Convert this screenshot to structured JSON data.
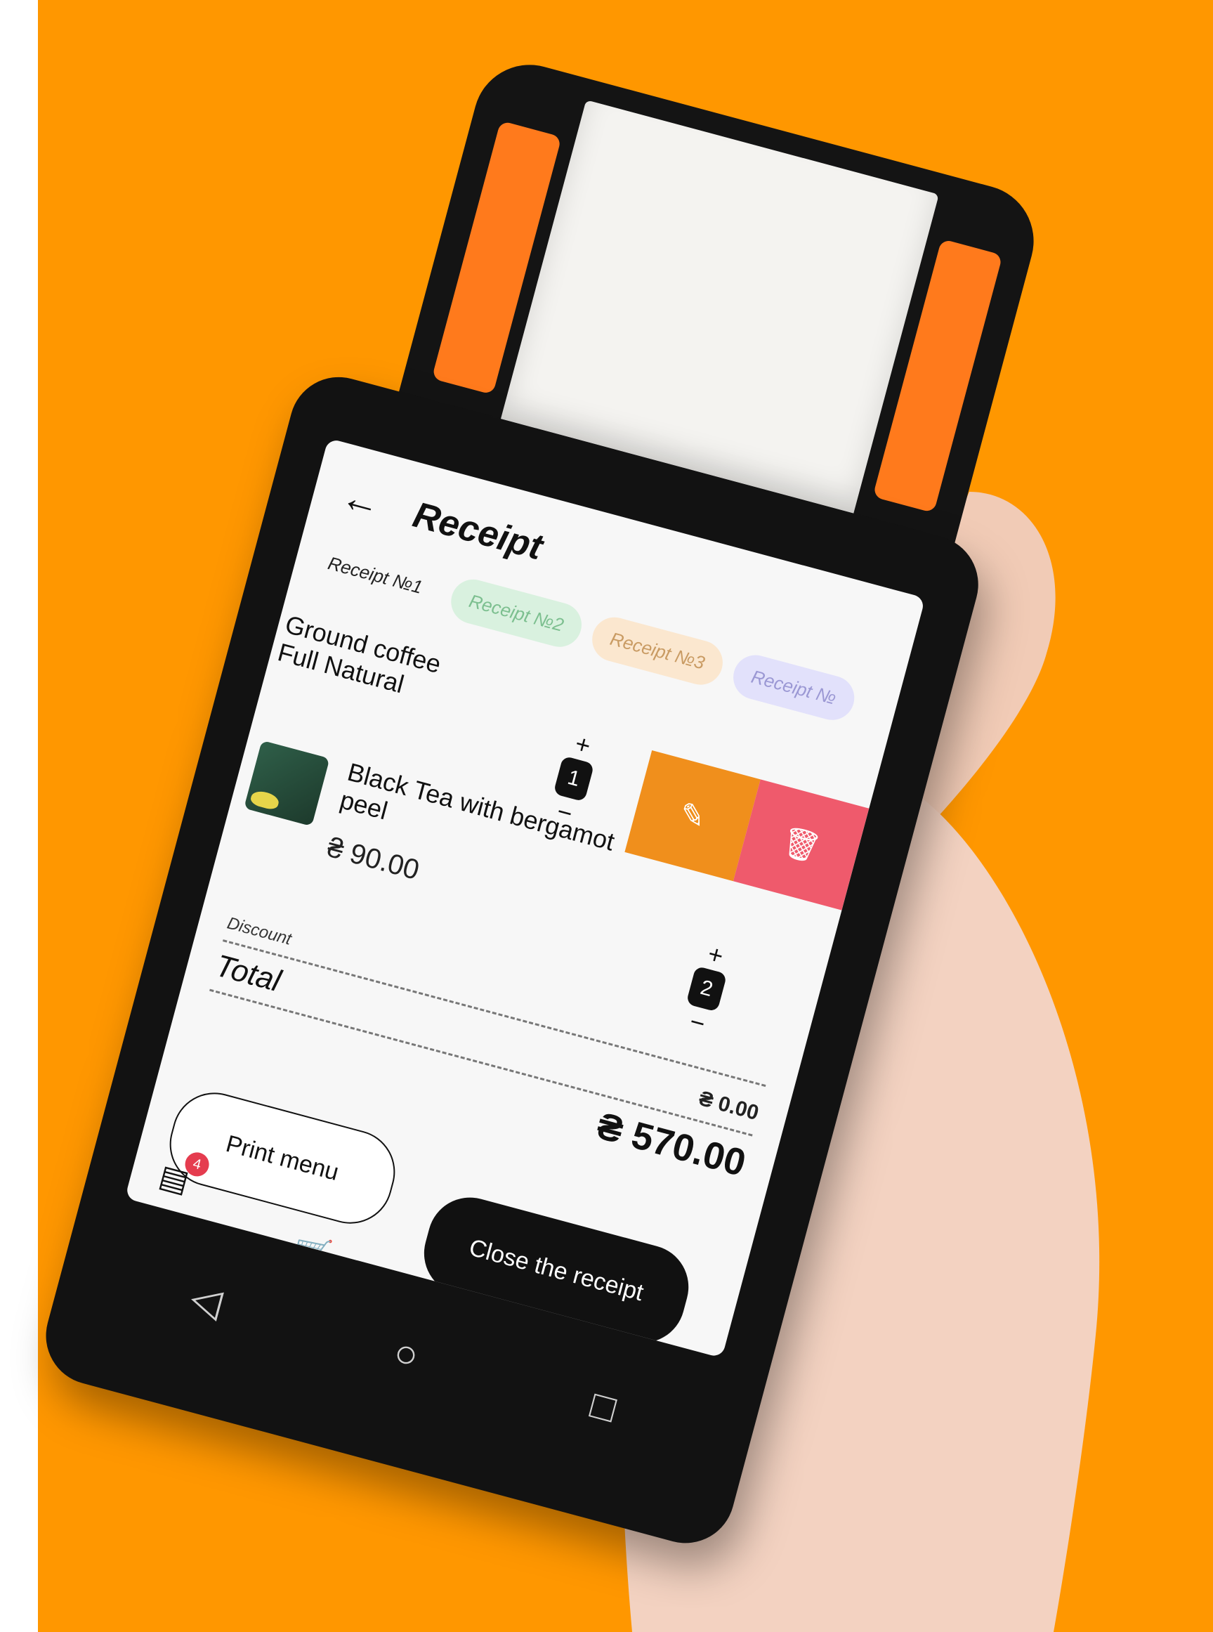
{
  "header": {
    "back_icon": "arrow-left-icon",
    "title": "Receipt",
    "search_icon": "search-icon"
  },
  "tabs": [
    {
      "label": "Receipt №1",
      "color": "transparent"
    },
    {
      "label": "Receipt №2",
      "color": "#d9f1df"
    },
    {
      "label": "Receipt №3",
      "color": "#fbe7cf"
    },
    {
      "label": "Receipt №",
      "color": "#e2e1fb"
    }
  ],
  "items": [
    {
      "name_line1": "Ground coffee",
      "name_line2": "Full Natural",
      "qty": "1",
      "plus": "+",
      "minus": "−",
      "actions": {
        "edit_icon": "pencil-icon",
        "delete_icon": "trash-icon"
      }
    },
    {
      "name": "Black Tea with bergamot peel",
      "price": "₴ 90.00",
      "qty": "2",
      "plus": "+",
      "minus": "−"
    }
  ],
  "summary": {
    "discount_label": "Discount",
    "discount_value": "₴ 0.00",
    "total_label": "Total",
    "total_value": "₴ 570.00"
  },
  "buttons": {
    "print": "Print menu",
    "close": "Close the receipt"
  },
  "bottom_nav": {
    "receipts_badge": "4",
    "icons": [
      "receipt-list-icon",
      "cart-icon",
      "profile-icon",
      "more-icon"
    ]
  },
  "system_nav": {
    "back": "◁",
    "home": "○",
    "recents": "□"
  },
  "colors": {
    "background": "#ff9700",
    "edit_action": "#f08f1c",
    "delete_action": "#ef5a6c",
    "badge": "#e53c4f"
  }
}
